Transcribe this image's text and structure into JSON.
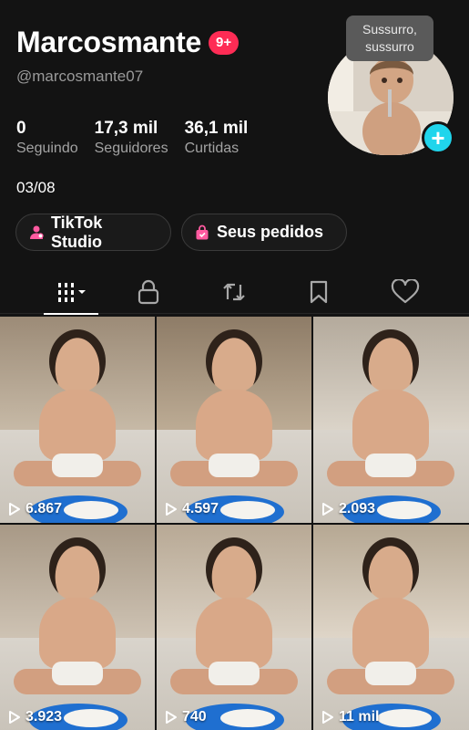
{
  "profile": {
    "display_name": "Marcosmante",
    "notification_badge": "9+",
    "handle": "@marcosmante07",
    "bio": "03/08",
    "stats": [
      {
        "value": "0",
        "label": "Seguindo"
      },
      {
        "value": "17,3 mil",
        "label": "Seguidores"
      },
      {
        "value": "36,1 mil",
        "label": "Curtidas"
      }
    ],
    "tooltip": [
      "Sussurro,",
      "sussurro"
    ],
    "add_icon": "plus-icon"
  },
  "buttons": {
    "studio_label": "TikTok Studio",
    "orders_label": "Seus pedidos"
  },
  "tabs": [
    {
      "icon": "grid-icon"
    },
    {
      "icon": "lock-icon"
    },
    {
      "icon": "repost-icon"
    },
    {
      "icon": "bookmark-icon"
    },
    {
      "icon": "heart-icon"
    }
  ],
  "videos": [
    {
      "views": "6.867"
    },
    {
      "views": "4.597"
    },
    {
      "views": "2.093"
    },
    {
      "views": "3.923"
    },
    {
      "views": "740"
    },
    {
      "views": "11 mil"
    }
  ],
  "colors": {
    "background": "#131313",
    "accent_red": "#fe2c55",
    "accent_cyan": "#20d5ec",
    "studio_icon": "#ff5aa0"
  }
}
